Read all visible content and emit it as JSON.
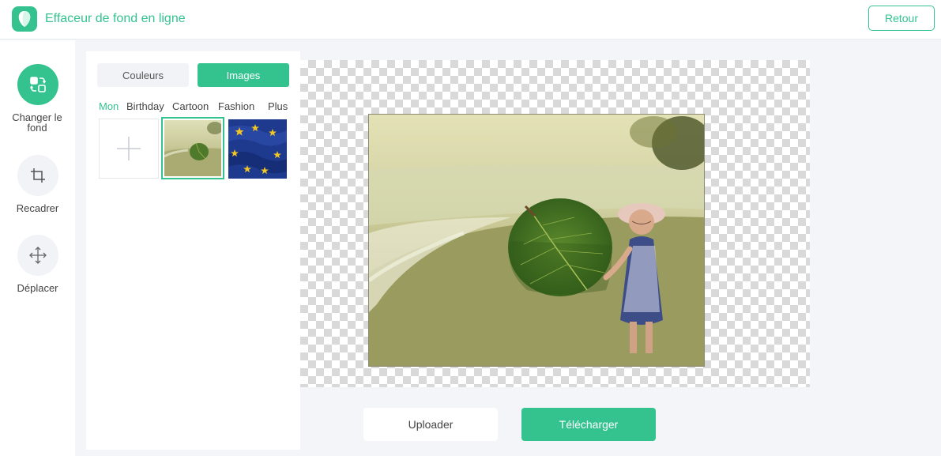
{
  "header": {
    "app_title": "Effaceur de fond en ligne",
    "back_label": "Retour"
  },
  "tools": [
    {
      "label": "Changer le fond",
      "icon": "swap-icon",
      "active": true
    },
    {
      "label": "Recadrer",
      "icon": "crop-icon",
      "active": false
    },
    {
      "label": "Déplacer",
      "icon": "move-icon",
      "active": false
    }
  ],
  "panel": {
    "tab_colors": "Couleurs",
    "tab_images": "Images",
    "active_tab": "Images",
    "categories": [
      "Mon",
      "Birthday",
      "Cartoon",
      "Fashion",
      "Plus"
    ],
    "active_category": "Mon",
    "thumbnails": [
      "add-background",
      "leaf-beach",
      "eu-flag"
    ],
    "selected_thumbnail": "leaf-beach"
  },
  "actions": {
    "upload_label": "Uploader",
    "download_label": "Télécharger"
  },
  "colors": {
    "accent": "#34c38f",
    "background": "#f3f5f8"
  }
}
